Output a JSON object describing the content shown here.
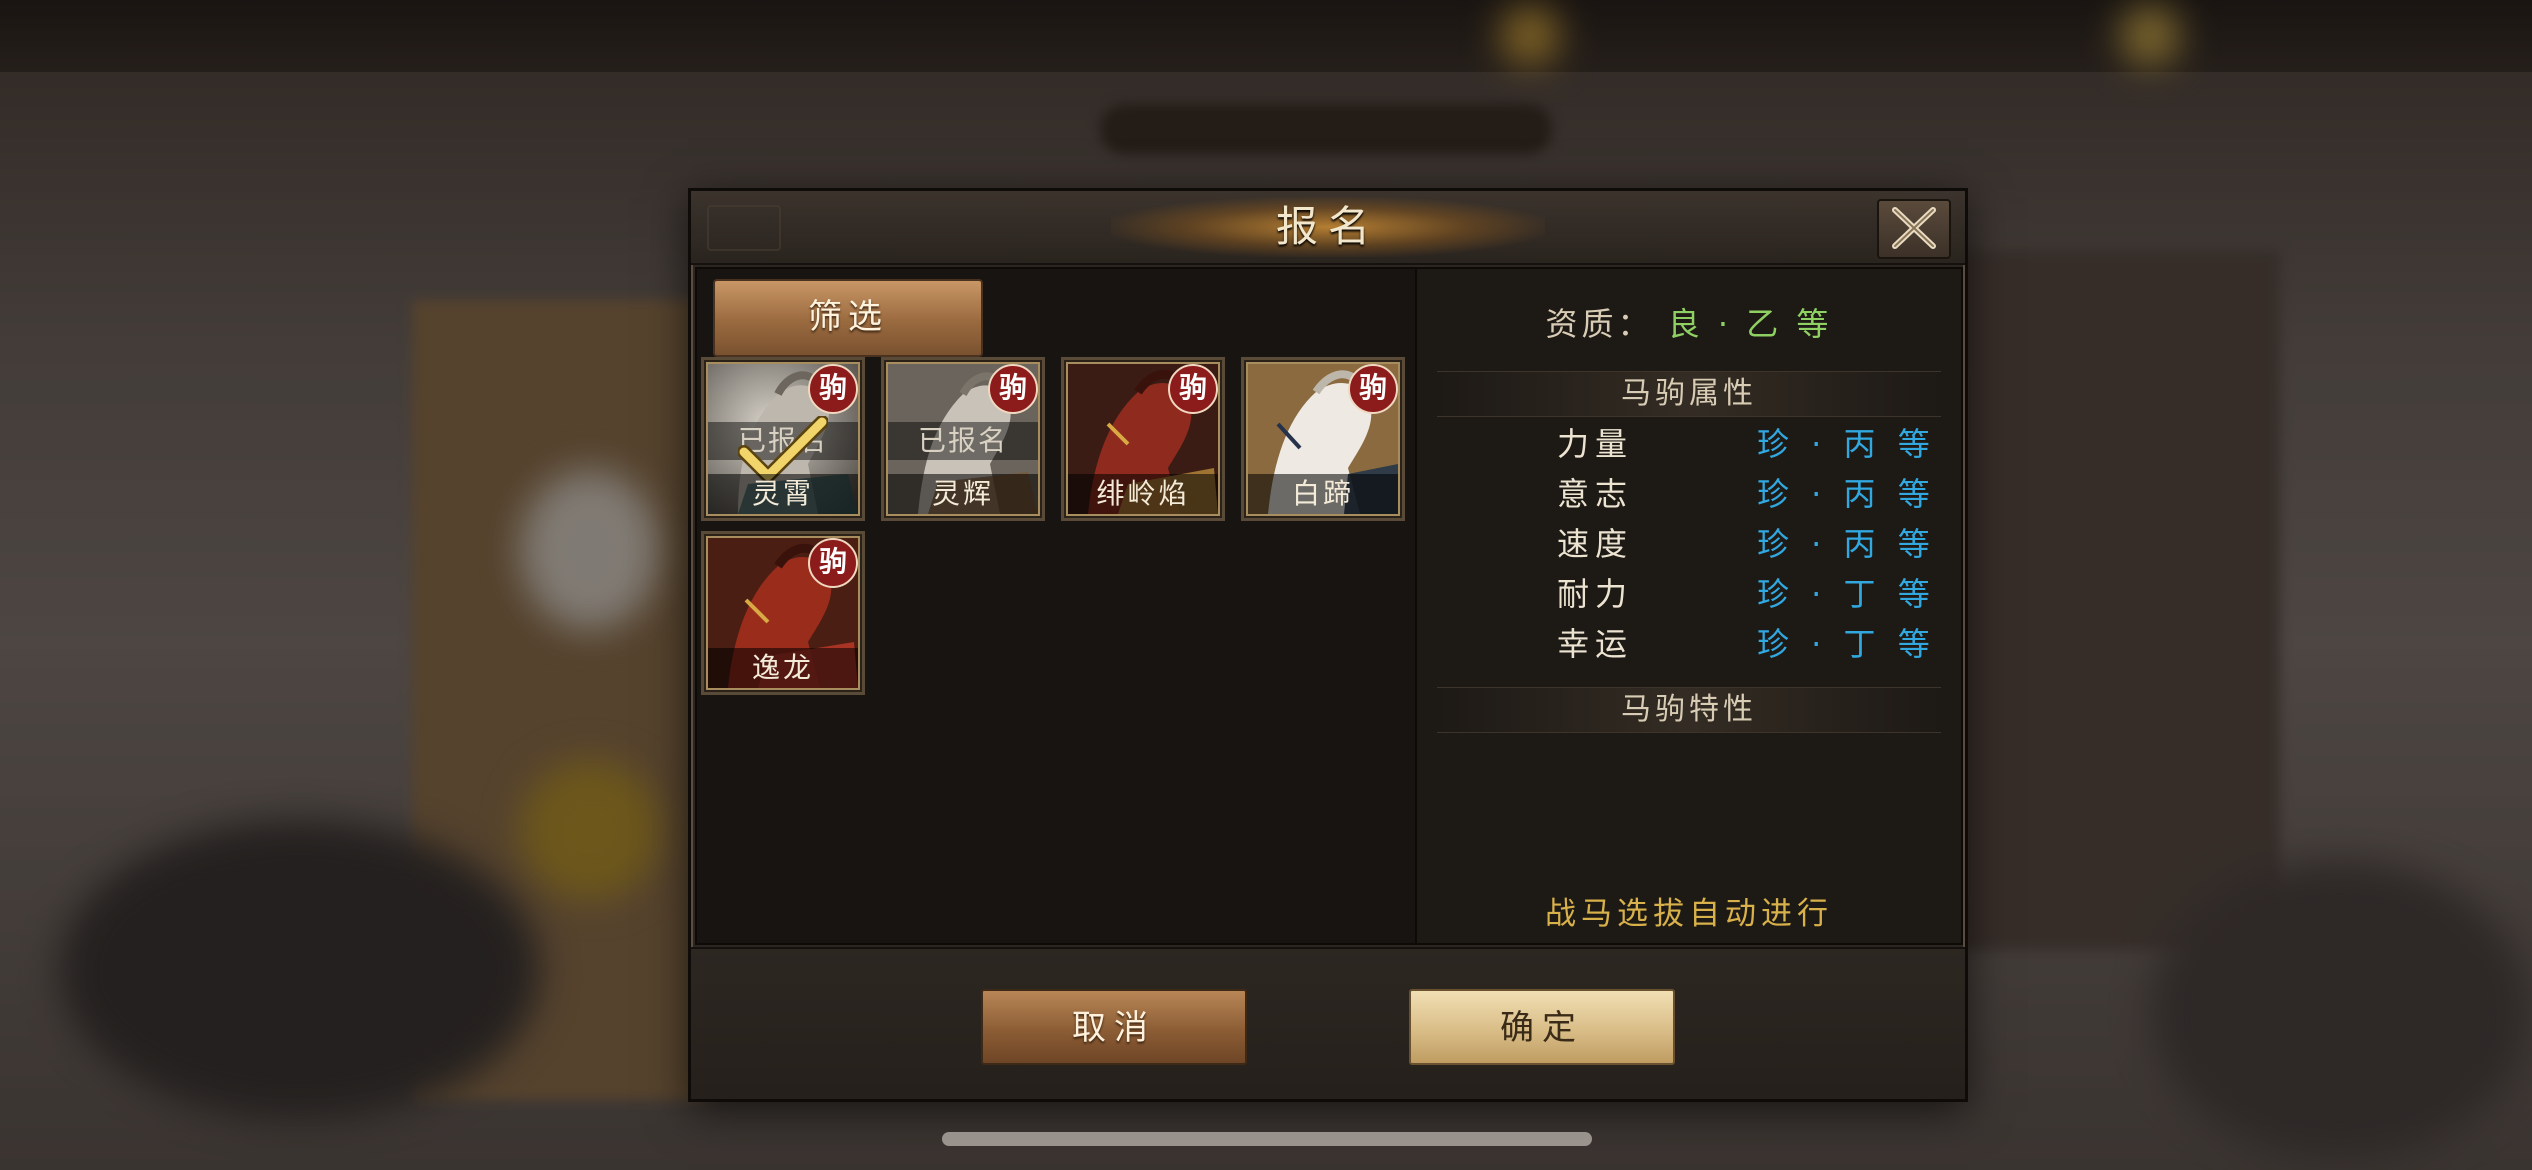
{
  "dialog": {
    "title": "报名",
    "filter_label": "筛选",
    "cancel_label": "取消",
    "confirm_label": "确定"
  },
  "horses": [
    {
      "name": "灵霄",
      "tag": "驹",
      "status": "已报名",
      "selected": true,
      "coat": "grey"
    },
    {
      "name": "灵辉",
      "tag": "驹",
      "status": "已报名",
      "selected": false,
      "coat": "grey"
    },
    {
      "name": "绯岭焰",
      "tag": "驹",
      "status": "",
      "selected": false,
      "coat": "red"
    },
    {
      "name": "白蹄",
      "tag": "驹",
      "status": "",
      "selected": false,
      "coat": "white"
    },
    {
      "name": "逸龙",
      "tag": "驹",
      "status": "",
      "selected": false,
      "coat": "red"
    }
  ],
  "details": {
    "quality_label": "资质：",
    "quality_value": "良 · 乙 等",
    "attributes_title": "马驹属性",
    "attributes": [
      {
        "name": "力量",
        "value": "珍 · 丙 等"
      },
      {
        "name": "意志",
        "value": "珍 · 丙 等"
      },
      {
        "name": "速度",
        "value": "珍 · 丙 等"
      },
      {
        "name": "耐力",
        "value": "珍 · 丁 等"
      },
      {
        "name": "幸运",
        "value": "珍 · 丁 等"
      }
    ],
    "traits_title": "马驹特性",
    "auto_note": "战马选拔自动进行"
  },
  "colors": {
    "quality": "#8fd063",
    "attribute_value": "#31a8e0",
    "note": "#d8b14a",
    "tag": "#8c1b1b"
  }
}
